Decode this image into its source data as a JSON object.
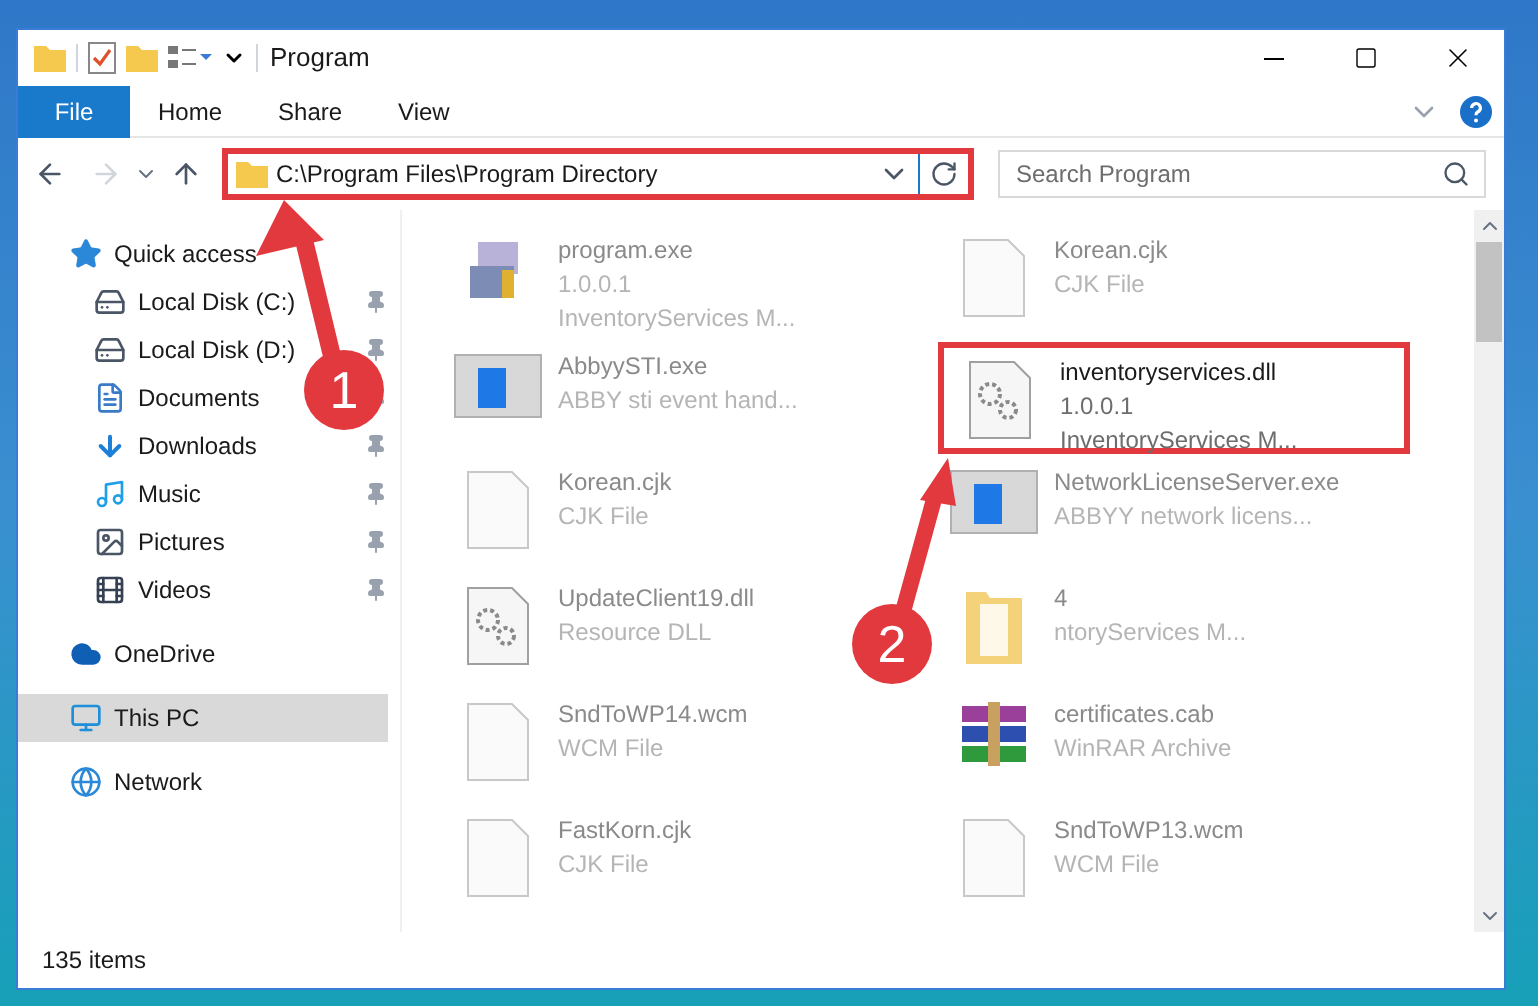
{
  "window": {
    "title": "Program"
  },
  "ribbon_tabs": [
    {
      "label": "File",
      "selected": true
    },
    {
      "label": "Home",
      "selected": false
    },
    {
      "label": "Share",
      "selected": false
    },
    {
      "label": "View",
      "selected": false
    }
  ],
  "address_bar": {
    "path": "C:\\Program Files\\Program Directory",
    "highlighted": true
  },
  "search": {
    "placeholder": "Search Program"
  },
  "sidebar": {
    "items": [
      {
        "label": "Quick access",
        "selected": false,
        "children": [
          {
            "label": "Local Disk (C:)",
            "pinned": true,
            "selected": false
          },
          {
            "label": "Local Disk (D:)",
            "pinned": true,
            "selected": false
          },
          {
            "label": "Documents",
            "pinned": true,
            "selected": false
          },
          {
            "label": "Downloads",
            "pinned": true,
            "selected": false
          },
          {
            "label": "Music",
            "pinned": true,
            "selected": false
          },
          {
            "label": "Pictures",
            "pinned": true,
            "selected": false
          },
          {
            "label": "Videos",
            "pinned": true,
            "selected": false
          }
        ]
      },
      {
        "label": "OneDrive",
        "selected": false
      },
      {
        "label": "This PC",
        "selected": true
      },
      {
        "label": "Network",
        "selected": false
      }
    ]
  },
  "files": [
    {
      "kind": "installer",
      "name": "program.exe",
      "details": [
        "1.0.0.1",
        "InventoryServices M..."
      ],
      "highlighted": false
    },
    {
      "kind": "document",
      "name": "Korean.cjk",
      "details": [
        "CJK File"
      ],
      "highlighted": false
    },
    {
      "kind": "window",
      "name": "AbbyySTI.exe",
      "details": [
        "ABBY sti event hand..."
      ],
      "highlighted": false
    },
    {
      "kind": "gear",
      "name": "inventoryservices.dll",
      "details": [
        "1.0.0.1",
        "InventoryServices M..."
      ],
      "highlighted": true
    },
    {
      "kind": "document",
      "name": "Korean.cjk",
      "details": [
        "CJK File"
      ],
      "highlighted": false
    },
    {
      "kind": "window",
      "name": "NetworkLicenseServer.exe",
      "details": [
        "ABBYY network licens..."
      ],
      "highlighted": false
    },
    {
      "kind": "gear",
      "name": "UpdateClient19.dll",
      "details": [
        "Resource DLL"
      ],
      "highlighted": false
    },
    {
      "kind": "folder",
      "name": "4",
      "details": [
        "ntoryServices M..."
      ],
      "highlighted": false
    },
    {
      "kind": "document",
      "name": "SndToWP14.wcm",
      "details": [
        "WCM File"
      ],
      "highlighted": false
    },
    {
      "kind": "archive",
      "name": "certificates.cab",
      "details": [
        "WinRAR Archive"
      ],
      "highlighted": false
    },
    {
      "kind": "document",
      "name": "FastKorn.cjk",
      "details": [
        "CJK File"
      ],
      "highlighted": false
    },
    {
      "kind": "document",
      "name": "SndToWP13.wcm",
      "details": [
        "WCM File"
      ],
      "highlighted": false
    }
  ],
  "status_bar": {
    "item_count": "135 items"
  },
  "annotations": [
    {
      "number": "1"
    },
    {
      "number": "2"
    }
  ]
}
